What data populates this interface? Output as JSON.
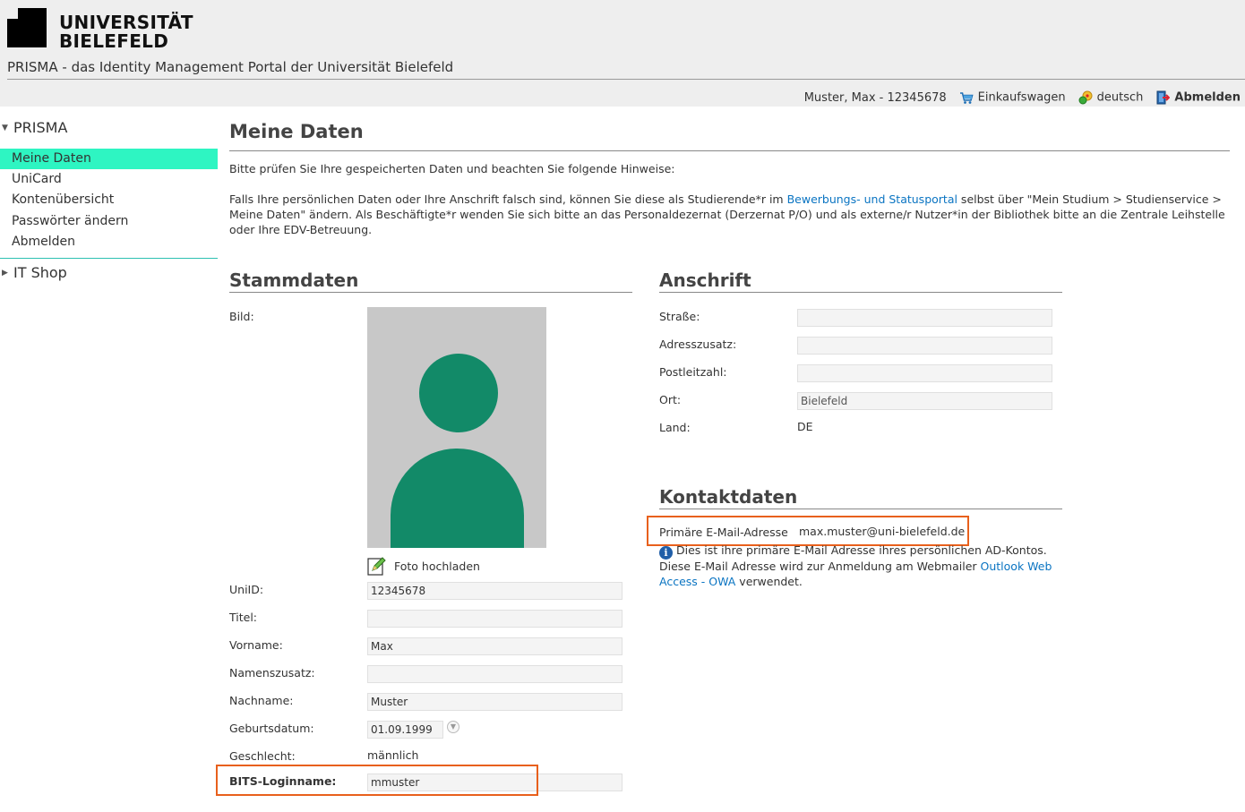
{
  "header": {
    "logo_line1": "UNIVERSITÄT",
    "logo_line2": "BIELEFELD",
    "portal_title": "PRISMA - das Identity Management Portal der Universität Bielefeld",
    "user": "Muster, Max - 12345678",
    "cart_label": "Einkaufswagen",
    "language_label": "deutsch",
    "logout_label": "Abmelden",
    "icons": [
      "cart-icon",
      "language-icon",
      "logout-icon"
    ]
  },
  "sidebar": {
    "section_prisma": "PRISMA",
    "items": [
      {
        "label": "Meine Daten",
        "active": true
      },
      {
        "label": "UniCard"
      },
      {
        "label": "Kontenübersicht"
      },
      {
        "label": "Passwörter ändern"
      },
      {
        "label": "Abmelden"
      }
    ],
    "section_itshop": "IT Shop"
  },
  "main": {
    "title": "Meine Daten",
    "hint": "Bitte prüfen Sie Ihre gespeicherten Daten und beachten Sie folgende Hinweise:",
    "info_part1": "Falls Ihre persönlichen Daten oder Ihre Anschrift falsch sind, können Sie diese als Studierende*r im ",
    "info_link": "Bewerbungs- und Statusportal",
    "info_part2": " selbst über \"Mein Studium > Studienservice > Meine Daten\" ändern. Als Beschäftigte*r wenden Sie sich bitte an das Personaldezernat (Derzernat P/O) und als externe/r Nutzer*in der Bibliothek bitte an die Zentrale Leihstelle oder Ihre EDV-Betreuung."
  },
  "stammdaten": {
    "title": "Stammdaten",
    "bild_label": "Bild:",
    "upload_label": "Foto hochladen",
    "uniid_label": "UniID:",
    "uniid_value": "12345678",
    "titel_label": "Titel:",
    "titel_value": "",
    "vorname_label": "Vorname:",
    "vorname_value": "Max",
    "namenszusatz_label": "Namenszusatz:",
    "namenszusatz_value": "",
    "nachname_label": "Nachname:",
    "nachname_value": "Muster",
    "geburtsdatum_label": "Geburtsdatum:",
    "geburtsdatum_value": "01.09.1999",
    "geschlecht_label": "Geschlecht:",
    "geschlecht_value": "männlich",
    "bits_label": "BITS-Loginname:",
    "bits_value": "mmuster"
  },
  "anschrift": {
    "title": "Anschrift",
    "strasse_label": "Straße:",
    "strasse_value": "",
    "adresszusatz_label": "Adresszusatz:",
    "adresszusatz_value": "",
    "plz_label": "Postleitzahl:",
    "plz_value": "",
    "ort_label": "Ort:",
    "ort_value": "Bielefeld",
    "land_label": "Land:",
    "land_value": "DE"
  },
  "kontakt": {
    "title": "Kontaktdaten",
    "email_label": "Primäre E-Mail-Adresse",
    "email_value": "max.muster@uni-bielefeld.de",
    "note_part1": "Dies ist ihre primäre E-Mail Adresse ihres persönlichen AD-Kontos. Diese E-Mail Adresse wird zur Anmeldung am Webmailer ",
    "note_link": "Outlook Web Access - OWA",
    "note_part2": " verwendet."
  },
  "colors": {
    "active_nav": "#2ef5c2",
    "highlight_box": "#e8601c",
    "link": "#0a74c2",
    "avatar": "#128a68"
  }
}
